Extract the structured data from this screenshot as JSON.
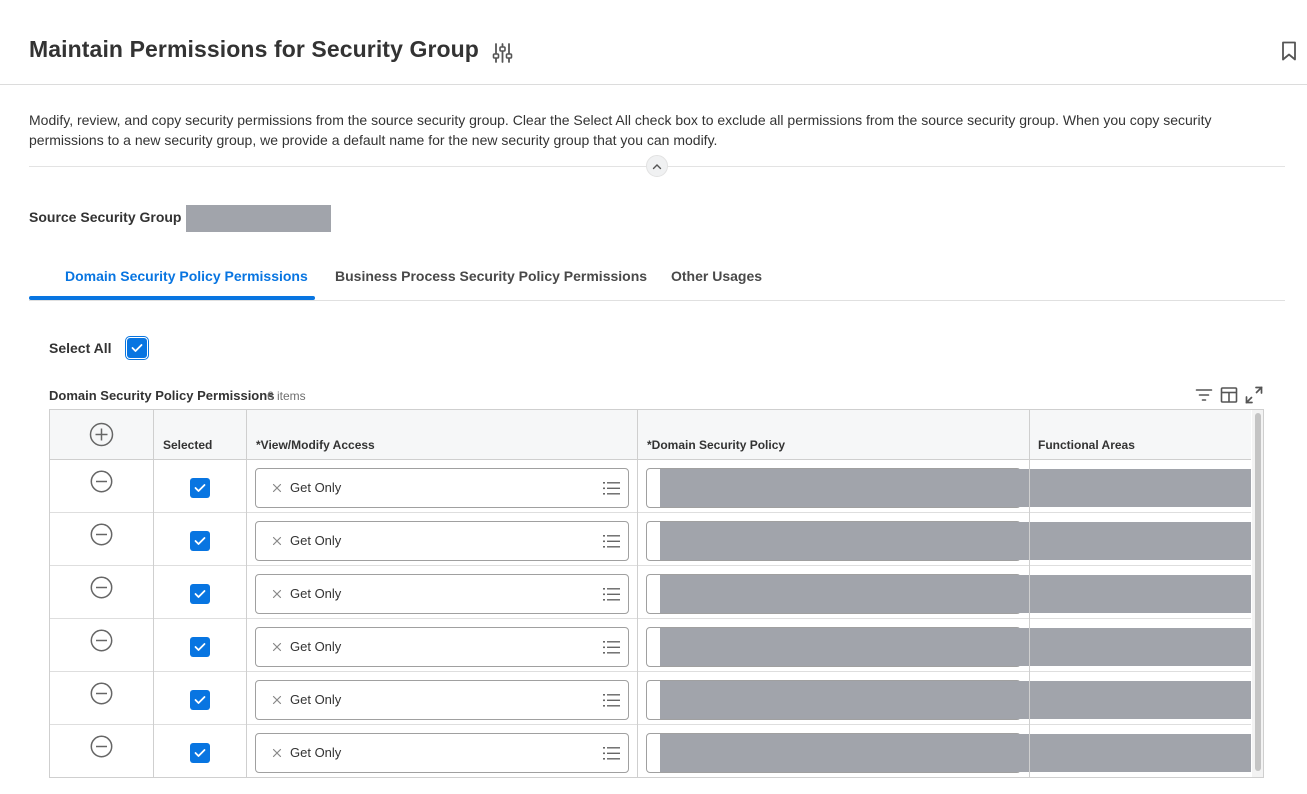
{
  "header": {
    "title": "Maintain Permissions for Security Group"
  },
  "description": "Modify, review, and copy security permissions from the source security group. Clear the Select All check box to exclude all permissions from the source security group. When you copy security permissions to a new security group, we provide a default name for the new security group that you can modify.",
  "source": {
    "label": "Source Security Group"
  },
  "tabs": [
    {
      "label": "Domain Security Policy Permissions",
      "active": true
    },
    {
      "label": "Business Process Security Policy Permissions",
      "active": false
    },
    {
      "label": "Other Usages",
      "active": false
    }
  ],
  "select_all": {
    "label": "Select All",
    "checked": true
  },
  "grid": {
    "title": "Domain Security Policy Permissions",
    "count": "6 items",
    "columns": [
      "Selected",
      "*View/Modify Access",
      "*Domain Security Policy",
      "Functional Areas"
    ],
    "rows": [
      {
        "selected": true,
        "access": "Get Only"
      },
      {
        "selected": true,
        "access": "Get Only"
      },
      {
        "selected": true,
        "access": "Get Only"
      },
      {
        "selected": true,
        "access": "Get Only"
      },
      {
        "selected": true,
        "access": "Get Only"
      },
      {
        "selected": true,
        "access": "Get Only"
      }
    ]
  },
  "colors": {
    "accent": "#0875e1",
    "redacted": "#a1a4ab",
    "text": "#333333"
  },
  "icons": [
    "tune-icon",
    "bookmark-icon",
    "chevron-up-icon",
    "add-circle-icon",
    "remove-circle-icon",
    "check-icon",
    "close-icon",
    "list-icon",
    "filter-icon",
    "column-layout-icon",
    "expand-icon"
  ]
}
